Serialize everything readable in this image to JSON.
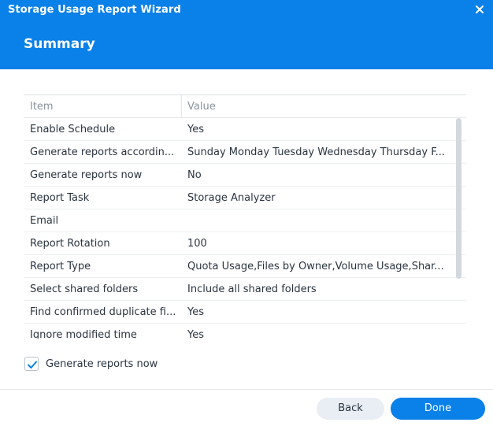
{
  "window": {
    "title": "Storage Usage Report Wizard"
  },
  "step": {
    "title": "Summary"
  },
  "table": {
    "columns": [
      "Item",
      "Value"
    ],
    "rows": [
      {
        "item": "Enable Schedule",
        "value": "Yes"
      },
      {
        "item": "Generate reports accordin...",
        "value": "Sunday Monday Tuesday Wednesday Thursday F..."
      },
      {
        "item": "Generate reports now",
        "value": "No"
      },
      {
        "item": "Report Task",
        "value": "Storage Analyzer"
      },
      {
        "item": "Email",
        "value": ""
      },
      {
        "item": "Report Rotation",
        "value": "100"
      },
      {
        "item": "Report Type",
        "value": "Quota Usage,Files by Owner,Volume Usage,Shar..."
      },
      {
        "item": "Select shared folders",
        "value": "Include all shared folders"
      },
      {
        "item": "Find confirmed duplicate fi...",
        "value": "Yes"
      },
      {
        "item": "Ignore modified time",
        "value": "Yes"
      }
    ]
  },
  "options": {
    "generate_now_label": "Generate reports now",
    "generate_now_checked": true
  },
  "footer": {
    "back_label": "Back",
    "done_label": "Done"
  },
  "colors": {
    "accent": "#0a81e8",
    "header_text": "#ffffff",
    "text": "#2a3440",
    "muted": "#8a949e"
  },
  "icons": {
    "close": "close-icon",
    "check": "checkmark-icon"
  }
}
